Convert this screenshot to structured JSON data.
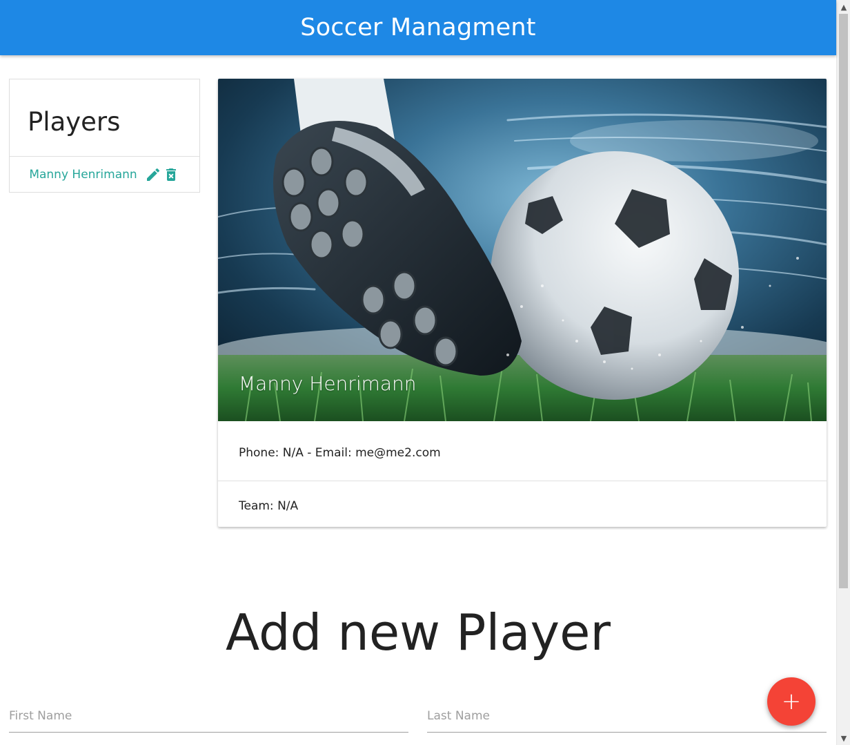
{
  "header": {
    "title": "Soccer Managment"
  },
  "sidebar": {
    "title": "Players",
    "players": [
      {
        "name": "Manny Henrimann",
        "edit_icon": "pencil-icon",
        "delete_icon": "trash-x-icon"
      }
    ]
  },
  "detail": {
    "name": "Manny Henrimann",
    "contact": "Phone: N/A - Email: me@me2.com",
    "team": "Team: N/A",
    "image": "soccer-boot-kicking-ball-photo"
  },
  "add_player": {
    "heading": "Add new Player",
    "first_name_placeholder": "First Name",
    "last_name_placeholder": "Last Name",
    "fab_label": "+",
    "fab_icon": "plus-icon"
  },
  "colors": {
    "app_bar": "#1e88e5",
    "accent_teal": "#26a69a",
    "fab_red": "#f44336"
  }
}
